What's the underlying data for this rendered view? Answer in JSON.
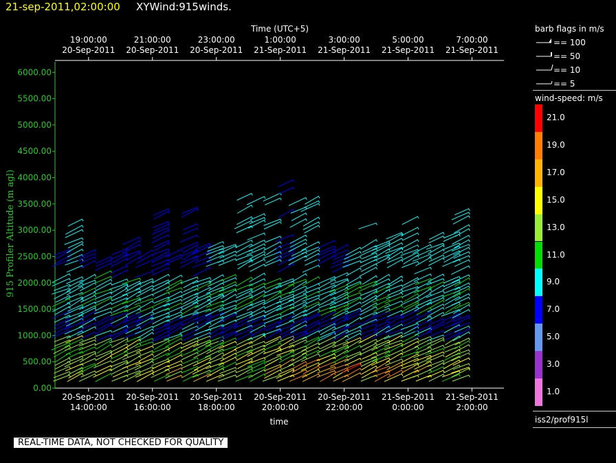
{
  "header": {
    "datetime": "21-sep-2011,02:00:00",
    "product": "XYWind:915winds."
  },
  "colors": {
    "title_time": "#ffff00",
    "y_axis": "#22cc22",
    "background": "#000000"
  },
  "legend": {
    "barb_title": "barb flags in m/s",
    "barbs": [
      "== 100",
      "== 50",
      "== 10",
      "== 5"
    ],
    "windspeed_title": "wind-speed: m/s",
    "colorbar": [
      {
        "label": "21.0",
        "color": "#ff0000"
      },
      {
        "label": "19.0",
        "color": "#ff7f00"
      },
      {
        "label": "17.0",
        "color": "#ffb400"
      },
      {
        "label": "15.0",
        "color": "#ffff00"
      },
      {
        "label": "13.0",
        "color": "#99ee33"
      },
      {
        "label": "11.0",
        "color": "#00dd00"
      },
      {
        "label": "9.0",
        "color": "#00ffff"
      },
      {
        "label": "7.0",
        "color": "#0000ff"
      },
      {
        "label": "5.0",
        "color": "#6699ee"
      },
      {
        "label": "3.0",
        "color": "#9933cc"
      },
      {
        "label": "1.0",
        "color": "#ee77dd"
      }
    ],
    "source": "iss2/prof915l"
  },
  "footer": {
    "quality_note": "REAL-TIME DATA, NOT CHECKED FOR QUALITY"
  },
  "chart_data": {
    "type": "scatter",
    "xlabel": "time",
    "x2label": "Time (UTC+5)",
    "ylabel": "915 Profiler Altitude (m agl)",
    "ylim": [
      0,
      6200
    ],
    "yticks": [
      "0.00",
      "500.00",
      "1000.00",
      "1500.00",
      "2000.00",
      "2500.00",
      "3000.00",
      "3500.00",
      "4000.00",
      "4500.00",
      "5000.00",
      "5500.00",
      "6000.00"
    ],
    "xticks_bottom": [
      [
        "20-Sep-2011",
        "14:00:00"
      ],
      [
        "20-Sep-2011",
        "16:00:00"
      ],
      [
        "20-Sep-2011",
        "18:00:00"
      ],
      [
        "20-Sep-2011",
        "20:00:00"
      ],
      [
        "20-Sep-2011",
        "22:00:00"
      ],
      [
        "21-Sep-2011",
        "0:00:00"
      ],
      [
        "21-Sep-2011",
        "2:00:00"
      ]
    ],
    "xticks_top": [
      [
        "19:00:00",
        "20-Sep-2011"
      ],
      [
        "21:00:00",
        "20-Sep-2011"
      ],
      [
        "23:00:00",
        "20-Sep-2011"
      ],
      [
        "1:00:00",
        "21-Sep-2011"
      ],
      [
        "3:00:00",
        "21-Sep-2011"
      ],
      [
        "5:00:00",
        "21-Sep-2011"
      ],
      [
        "7:00:00",
        "21-Sep-2011"
      ]
    ],
    "profile_times_hours": [
      13.4,
      13.8,
      14.2,
      14.7,
      15.2,
      15.6,
      16.0,
      16.5,
      16.9,
      17.4,
      17.8,
      18.2,
      18.6,
      19.1,
      19.5,
      20.0,
      20.4,
      20.8,
      21.2,
      21.7,
      22.1,
      22.5,
      23.0,
      23.4,
      23.8,
      24.3,
      24.7,
      25.1,
      25.6,
      25.9
    ],
    "profile_tops_m": [
      2600,
      3150,
      2550,
      2450,
      2600,
      2800,
      2500,
      3450,
      2550,
      3400,
      2850,
      2800,
      2650,
      3600,
      3550,
      3650,
      3950,
      3850,
      3800,
      2700,
      2650,
      2600,
      3050,
      2700,
      2950,
      3350,
      2650,
      3000,
      2900,
      3350
    ],
    "upper_layer_speeds_ms": [
      7,
      9,
      7,
      7,
      7,
      7,
      7,
      7,
      7,
      7,
      7,
      9,
      9,
      9,
      9,
      9,
      7,
      9,
      9,
      7,
      7,
      9,
      9,
      9,
      9,
      9,
      9,
      9,
      9,
      9
    ],
    "low_layer_speeds_ms": [
      15,
      15,
      15,
      15,
      15,
      15,
      15,
      15,
      17,
      15,
      17,
      15,
      15,
      15,
      15,
      17,
      17,
      19,
      19,
      21,
      19,
      21,
      15,
      21,
      19,
      17,
      17,
      15,
      15,
      15
    ]
  }
}
